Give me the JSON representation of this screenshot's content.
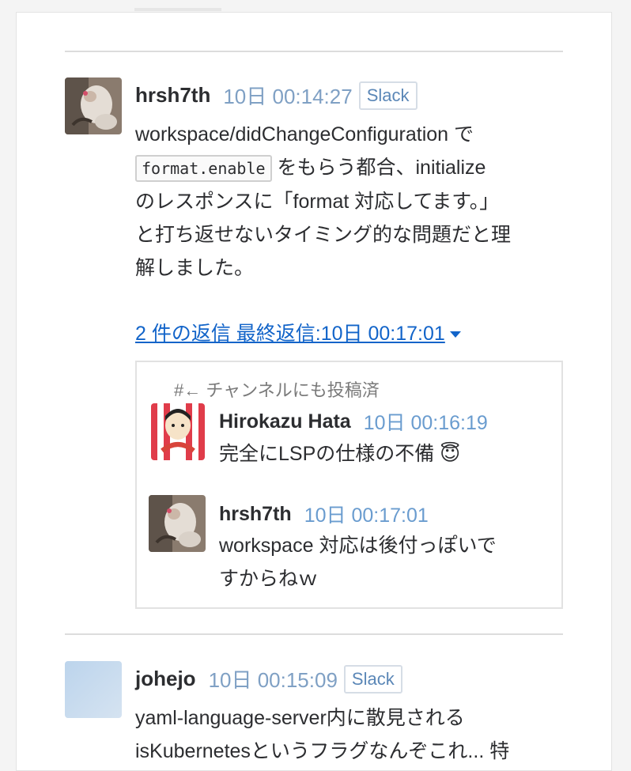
{
  "messages": [
    {
      "author": "hrsh7th",
      "timestamp": "10日 00:14:27",
      "badge": "Slack",
      "text_line1": "workspace/didChangeConfiguration で",
      "code": "format.enable",
      "text_line2_after_code": " をもらう都合、initialize",
      "text_line3": "のレスポンスに「format 対応してます。」",
      "text_line4": "と打ち返せないタイミング的な問題だと理",
      "text_line5": "解しました。",
      "thread_link": "2 件の返信 最終返信:10日 00:17:01",
      "thread": {
        "broadcast_label": "#← チャンネルにも投稿済",
        "replies": [
          {
            "author": "Hirokazu Hata",
            "timestamp": "10日 00:16:19",
            "text": "完全にLSPの仕様の不備 😇"
          },
          {
            "author": "hrsh7th",
            "timestamp": "10日 00:17:01",
            "text_line1": "workspace 対応は後付っぽいで",
            "text_line2": "すからねｗ"
          }
        ]
      }
    },
    {
      "author": "johejo",
      "timestamp": "10日 00:15:09",
      "badge": "Slack",
      "text_line1": "yaml-language-server内に散見される",
      "text_line2": "isKubernetesというフラグなんぞこれ... 特"
    }
  ],
  "colors": {
    "link": "#1264c9",
    "timestamp": "#7fa0c4",
    "badge_text": "#5b87b7",
    "divider": "#dcdcdc"
  }
}
